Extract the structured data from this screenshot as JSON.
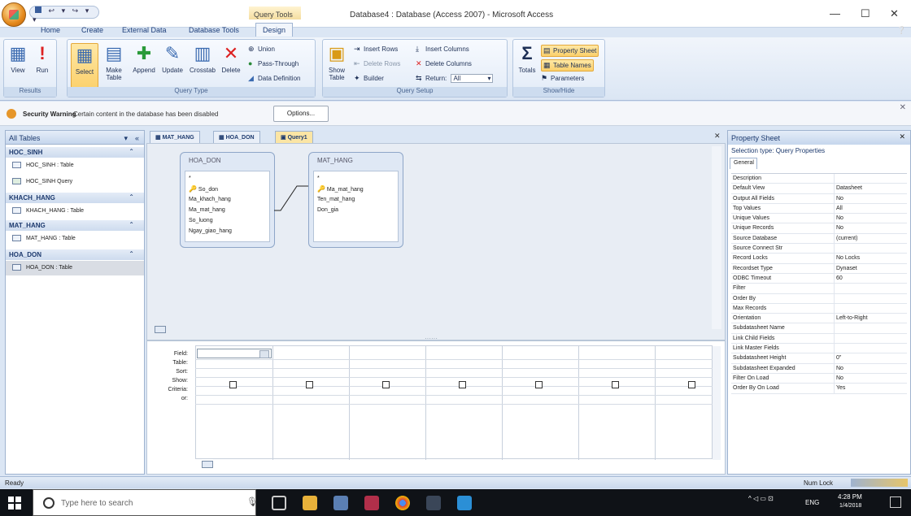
{
  "window": {
    "title": "Database4 : Database (Access 2007) - Microsoft Access",
    "context_tab_group": "Query Tools",
    "qat": [
      "↩",
      "▾",
      "↪",
      "▾",
      "▾"
    ],
    "controls": {
      "minimize": "—",
      "maximize": "☐",
      "close": "✕"
    }
  },
  "ribbon_tabs": [
    "Home",
    "Create",
    "External Data",
    "Database Tools",
    "Design"
  ],
  "ribbon": {
    "results": {
      "label": "Results",
      "view": "View",
      "run": "Run"
    },
    "query_type": {
      "label": "Query Type",
      "select": "Select",
      "make_table": "Make Table",
      "append": "Append",
      "update": "Update",
      "crosstab": "Crosstab",
      "delete": "Delete",
      "union": "Union",
      "pass_through": "Pass-Through",
      "data_definition": "Data Definition"
    },
    "query_setup": {
      "label": "Query Setup",
      "show_table": "Show Table",
      "insert_rows": "Insert Rows",
      "delete_rows": "Delete Rows",
      "builder": "Builder",
      "insert_columns": "Insert Columns",
      "delete_columns": "Delete Columns",
      "return_label": "Return:",
      "return_value": "All"
    },
    "show_hide": {
      "label": "Show/Hide",
      "totals": "Totals",
      "property_sheet": "Property Sheet",
      "table_names": "Table Names",
      "parameters": "Parameters"
    }
  },
  "security": {
    "title": "Security Warning",
    "message": "Certain content in the database has been disabled",
    "options_button": "Options..."
  },
  "nav": {
    "header": "All Tables",
    "groups": [
      {
        "name": "HOC_SINH",
        "items": [
          "HOC_SINH : Table",
          "HOC_SINH Query"
        ]
      },
      {
        "name": "KHACH_HANG",
        "items": [
          "KHACH_HANG : Table"
        ]
      },
      {
        "name": "MAT_HANG",
        "items": [
          "MAT_HANG : Table"
        ]
      },
      {
        "name": "HOA_DON",
        "items": [
          "HOA_DON : Table"
        ]
      }
    ]
  },
  "doc_tabs": [
    "MAT_HANG",
    "HOA_DON",
    "Query1"
  ],
  "tables": [
    {
      "name": "HOA_DON",
      "fields": [
        "*",
        "So_don",
        "Ma_khach_hang",
        "Ma_mat_hang",
        "So_luong",
        "Ngay_giao_hang"
      ],
      "key_field": "So_don"
    },
    {
      "name": "MAT_HANG",
      "fields": [
        "*",
        "Ma_mat_hang",
        "Ten_mat_hang",
        "Don_gia"
      ],
      "key_field": "Ma_mat_hang"
    }
  ],
  "grid": {
    "row_labels": [
      "Field:",
      "Table:",
      "Sort:",
      "Show:",
      "Criteria:",
      "or:"
    ]
  },
  "property_sheet": {
    "title": "Property Sheet",
    "selection_type": "Selection type:  Query Properties",
    "tab": "General",
    "rows": [
      [
        "Description",
        ""
      ],
      [
        "Default View",
        "Datasheet"
      ],
      [
        "Output All Fields",
        "No"
      ],
      [
        "Top Values",
        "All"
      ],
      [
        "Unique Values",
        "No"
      ],
      [
        "Unique Records",
        "No"
      ],
      [
        "Source Database",
        "(current)"
      ],
      [
        "Source Connect Str",
        ""
      ],
      [
        "Record Locks",
        "No Locks"
      ],
      [
        "Recordset Type",
        "Dynaset"
      ],
      [
        "ODBC Timeout",
        "60"
      ],
      [
        "Filter",
        ""
      ],
      [
        "Order By",
        ""
      ],
      [
        "Max Records",
        ""
      ],
      [
        "Orientation",
        "Left-to-Right"
      ],
      [
        "Subdatasheet Name",
        ""
      ],
      [
        "Link Child Fields",
        ""
      ],
      [
        "Link Master Fields",
        ""
      ],
      [
        "Subdatasheet Height",
        "0\""
      ],
      [
        "Subdatasheet Expanded",
        "No"
      ],
      [
        "Filter On Load",
        "No"
      ],
      [
        "Order By On Load",
        "Yes"
      ]
    ]
  },
  "status": {
    "left": "Ready",
    "num_lock": "Num Lock"
  },
  "taskbar": {
    "search_placeholder": "Type here to search",
    "lang": "ENG",
    "time": "4:28 PM",
    "date": "1/4/2018"
  }
}
